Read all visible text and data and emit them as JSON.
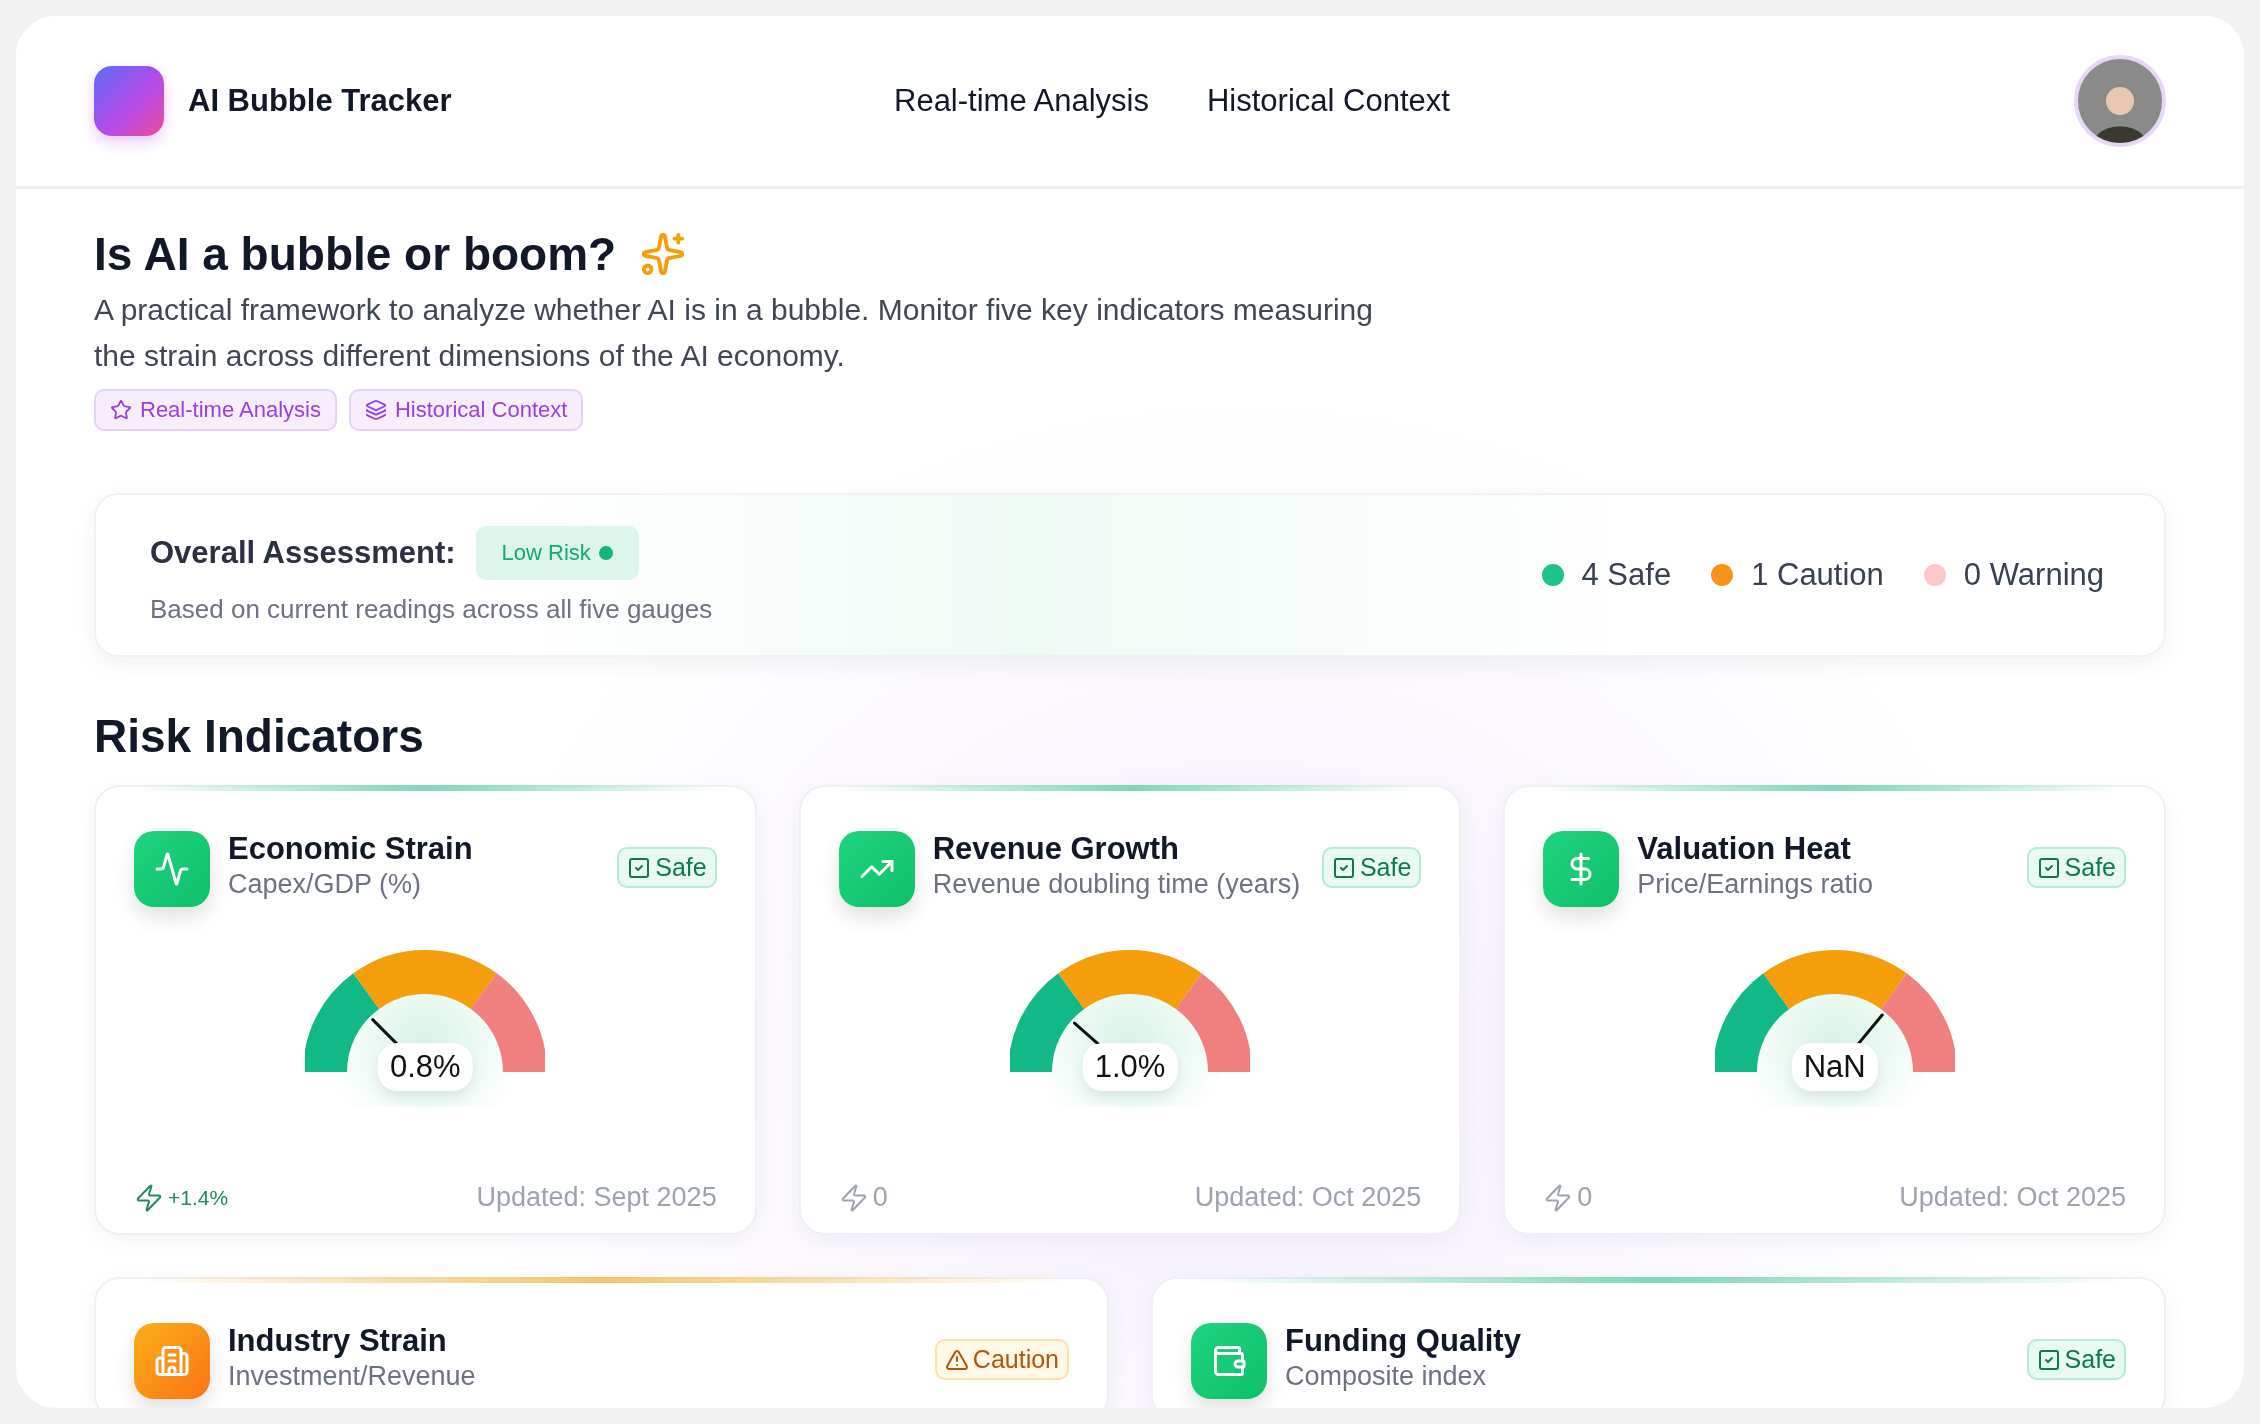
{
  "app": {
    "name": "AI Bubble Tracker"
  },
  "nav": [
    {
      "label": "Real-time Analysis"
    },
    {
      "label": "Historical Context"
    }
  ],
  "intro": {
    "title": "Is AI a bubble or boom?",
    "description": "A practical framework to analyze whether AI is in a bubble. Monitor five key indicators measuring the strain across different dimensions of the AI economy.",
    "tags": [
      {
        "label": "Real-time Analysis"
      },
      {
        "label": "Historical Context"
      }
    ]
  },
  "assessment": {
    "title": "Overall Assessment:",
    "risk": "Low Risk",
    "note": "Based on current readings across all five gauges",
    "legend": [
      {
        "label": "4 Safe",
        "color": "#1ec28b"
      },
      {
        "label": "1 Caution",
        "color": "#f7931a"
      },
      {
        "label": "0 Warning",
        "color": "#fbc7c9"
      }
    ]
  },
  "section_title": "Risk Indicators",
  "indicators": [
    {
      "title": "Economic Strain",
      "subtitle": "Capex/GDP (%)",
      "kind": "safe",
      "badge": "Safe",
      "value": "0.8%",
      "level": 0.25,
      "trend": {
        "text": "+1.4%",
        "positive": true
      },
      "updated": "Updated: Sept 2025"
    },
    {
      "title": "Revenue Growth",
      "subtitle": "Revenue doubling time (years)",
      "kind": "safe",
      "badge": "Safe",
      "value": "1.0%",
      "level": 0.23,
      "trend": {
        "text": "0",
        "positive": false
      },
      "updated": "Updated: Oct 2025"
    },
    {
      "title": "Valuation Heat",
      "subtitle": "Price/Earnings ratio",
      "kind": "safe",
      "badge": "Safe",
      "value": "NaN",
      "level": 0.72,
      "trend": {
        "text": "0",
        "positive": false
      },
      "updated": "Updated: Oct 2025"
    },
    {
      "title": "Industry Strain",
      "subtitle": "Investment/Revenue",
      "kind": "caution",
      "badge": "Caution"
    },
    {
      "title": "Funding Quality",
      "subtitle": "Composite index",
      "kind": "safe",
      "badge": "Safe"
    }
  ]
}
